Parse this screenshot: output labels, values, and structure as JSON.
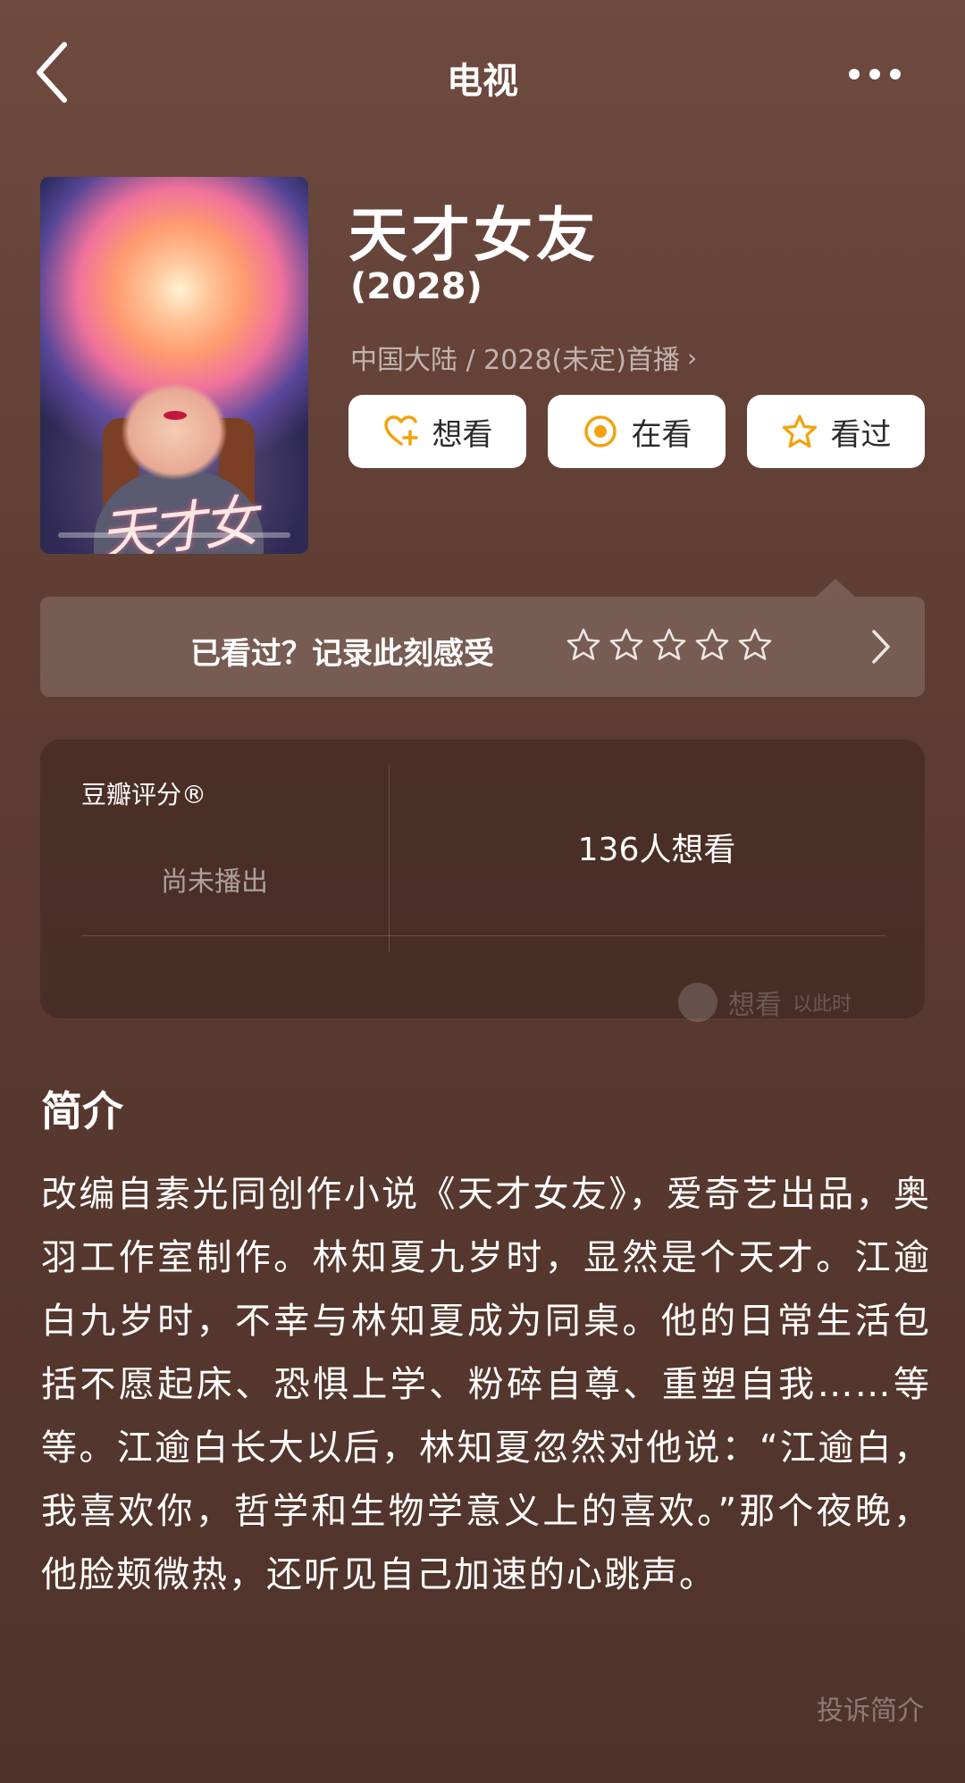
{
  "header": {
    "title": "电视",
    "back_icon": "chevron-left-icon",
    "more_icon": "more-dots-icon"
  },
  "show": {
    "title": "天才女友",
    "year": "(2028)",
    "meta": "中国大陆 / 2028(未定)首播",
    "poster_logo_text": "天才女友"
  },
  "actions": [
    {
      "label": "想看",
      "icon": "heart-plus-icon"
    },
    {
      "label": "在看",
      "icon": "target-circle-icon"
    },
    {
      "label": "看过",
      "icon": "star-icon"
    }
  ],
  "record": {
    "text": "已看过？记录此刻感受",
    "star_count": 5
  },
  "rating": {
    "label": "豆瓣评分®",
    "status": "尚未播出",
    "want_count_text": "136人想看",
    "footer_text": "想看",
    "footer_sub": "以此时"
  },
  "synopsis": {
    "title": "简介",
    "body": "改编自素光同创作小说《天才女友》，爱奇艺出品，奥羽工作室制作。林知夏九岁时，显然是个天才。江逾白九岁时，不幸与林知夏成为同桌。他的日常生活包括不愿起床、恐惧上学、粉碎自尊、重塑自我……等等。江逾白长大以后，林知夏忽然对他说：“江逾白，我喜欢你，哲学和生物学意义上的喜欢。”那个夜晚，他脸颊微热，还听见自己加速的心跳声。",
    "report_label": "投诉简介"
  },
  "colors": {
    "background": "#5e3d33",
    "icon_accent": "#f2a20c"
  }
}
